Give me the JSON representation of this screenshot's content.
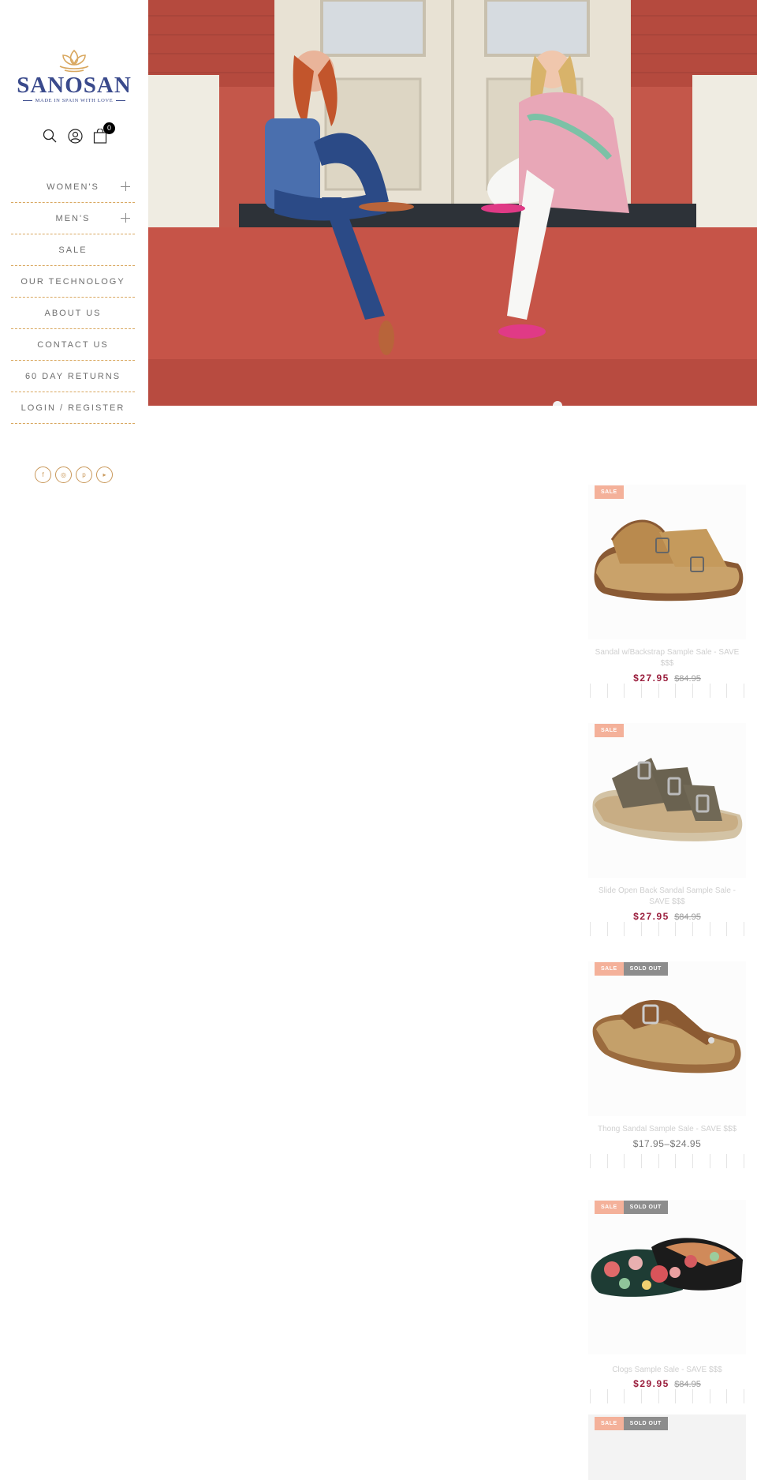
{
  "brand": {
    "name": "SANOSAN",
    "tagline": "MADE IN SPAIN WITH LOVE",
    "colors": {
      "primary": "#3a4a8c",
      "accent": "#d9a860",
      "sale_price": "#9a1e3d"
    }
  },
  "header": {
    "icons": [
      "search-icon",
      "account-icon",
      "cart-icon"
    ],
    "cart_count": "0"
  },
  "nav": [
    {
      "label": "WOMEN'S",
      "expandable": true
    },
    {
      "label": "MEN'S",
      "expandable": true
    },
    {
      "label": "SALE",
      "expandable": false
    },
    {
      "label": "OUR TECHNOLOGY",
      "expandable": false
    },
    {
      "label": "ABOUT US",
      "expandable": false
    },
    {
      "label": "CONTACT US",
      "expandable": false
    },
    {
      "label": "60 DAY RETURNS",
      "expandable": false
    },
    {
      "label": "LOGIN / REGISTER",
      "expandable": false
    }
  ],
  "social": [
    "facebook-icon",
    "instagram-icon",
    "pinterest-icon",
    "youtube-icon"
  ],
  "badges": {
    "sale": "SALE",
    "sold_out": "SOLD OUT"
  },
  "products": [
    {
      "title": "Sandal w/Backstrap Sample Sale - SAVE $$$",
      "price": "$27.95",
      "compare_price": "$84.95",
      "sale": true,
      "sold_out": false
    },
    {
      "title": "Slide Open Back Sandal Sample Sale - SAVE $$$",
      "price": "$27.95",
      "compare_price": "$84.95",
      "sale": true,
      "sold_out": false
    },
    {
      "title": "Thong Sandal Sample Sale - SAVE $$$",
      "price_range": "$17.95–$24.95",
      "sale": true,
      "sold_out": true
    },
    {
      "title": "Clogs Sample Sale - SAVE $$$",
      "price": "$29.95",
      "compare_price": "$84.95",
      "sale": true,
      "sold_out": true
    },
    {
      "title": "",
      "sale": true,
      "sold_out": true
    }
  ]
}
